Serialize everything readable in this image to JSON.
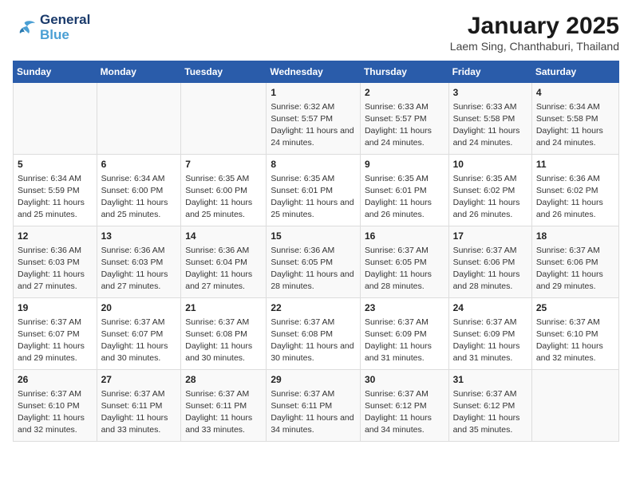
{
  "header": {
    "logo_line1": "General",
    "logo_line2": "Blue",
    "main_title": "January 2025",
    "sub_title": "Laem Sing, Chanthaburi, Thailand"
  },
  "weekdays": [
    "Sunday",
    "Monday",
    "Tuesday",
    "Wednesday",
    "Thursday",
    "Friday",
    "Saturday"
  ],
  "weeks": [
    [
      {
        "day": "",
        "text": ""
      },
      {
        "day": "",
        "text": ""
      },
      {
        "day": "",
        "text": ""
      },
      {
        "day": "1",
        "text": "Sunrise: 6:32 AM\nSunset: 5:57 PM\nDaylight: 11 hours and 24 minutes."
      },
      {
        "day": "2",
        "text": "Sunrise: 6:33 AM\nSunset: 5:57 PM\nDaylight: 11 hours and 24 minutes."
      },
      {
        "day": "3",
        "text": "Sunrise: 6:33 AM\nSunset: 5:58 PM\nDaylight: 11 hours and 24 minutes."
      },
      {
        "day": "4",
        "text": "Sunrise: 6:34 AM\nSunset: 5:58 PM\nDaylight: 11 hours and 24 minutes."
      }
    ],
    [
      {
        "day": "5",
        "text": "Sunrise: 6:34 AM\nSunset: 5:59 PM\nDaylight: 11 hours and 25 minutes."
      },
      {
        "day": "6",
        "text": "Sunrise: 6:34 AM\nSunset: 6:00 PM\nDaylight: 11 hours and 25 minutes."
      },
      {
        "day": "7",
        "text": "Sunrise: 6:35 AM\nSunset: 6:00 PM\nDaylight: 11 hours and 25 minutes."
      },
      {
        "day": "8",
        "text": "Sunrise: 6:35 AM\nSunset: 6:01 PM\nDaylight: 11 hours and 25 minutes."
      },
      {
        "day": "9",
        "text": "Sunrise: 6:35 AM\nSunset: 6:01 PM\nDaylight: 11 hours and 26 minutes."
      },
      {
        "day": "10",
        "text": "Sunrise: 6:35 AM\nSunset: 6:02 PM\nDaylight: 11 hours and 26 minutes."
      },
      {
        "day": "11",
        "text": "Sunrise: 6:36 AM\nSunset: 6:02 PM\nDaylight: 11 hours and 26 minutes."
      }
    ],
    [
      {
        "day": "12",
        "text": "Sunrise: 6:36 AM\nSunset: 6:03 PM\nDaylight: 11 hours and 27 minutes."
      },
      {
        "day": "13",
        "text": "Sunrise: 6:36 AM\nSunset: 6:03 PM\nDaylight: 11 hours and 27 minutes."
      },
      {
        "day": "14",
        "text": "Sunrise: 6:36 AM\nSunset: 6:04 PM\nDaylight: 11 hours and 27 minutes."
      },
      {
        "day": "15",
        "text": "Sunrise: 6:36 AM\nSunset: 6:05 PM\nDaylight: 11 hours and 28 minutes."
      },
      {
        "day": "16",
        "text": "Sunrise: 6:37 AM\nSunset: 6:05 PM\nDaylight: 11 hours and 28 minutes."
      },
      {
        "day": "17",
        "text": "Sunrise: 6:37 AM\nSunset: 6:06 PM\nDaylight: 11 hours and 28 minutes."
      },
      {
        "day": "18",
        "text": "Sunrise: 6:37 AM\nSunset: 6:06 PM\nDaylight: 11 hours and 29 minutes."
      }
    ],
    [
      {
        "day": "19",
        "text": "Sunrise: 6:37 AM\nSunset: 6:07 PM\nDaylight: 11 hours and 29 minutes."
      },
      {
        "day": "20",
        "text": "Sunrise: 6:37 AM\nSunset: 6:07 PM\nDaylight: 11 hours and 30 minutes."
      },
      {
        "day": "21",
        "text": "Sunrise: 6:37 AM\nSunset: 6:08 PM\nDaylight: 11 hours and 30 minutes."
      },
      {
        "day": "22",
        "text": "Sunrise: 6:37 AM\nSunset: 6:08 PM\nDaylight: 11 hours and 30 minutes."
      },
      {
        "day": "23",
        "text": "Sunrise: 6:37 AM\nSunset: 6:09 PM\nDaylight: 11 hours and 31 minutes."
      },
      {
        "day": "24",
        "text": "Sunrise: 6:37 AM\nSunset: 6:09 PM\nDaylight: 11 hours and 31 minutes."
      },
      {
        "day": "25",
        "text": "Sunrise: 6:37 AM\nSunset: 6:10 PM\nDaylight: 11 hours and 32 minutes."
      }
    ],
    [
      {
        "day": "26",
        "text": "Sunrise: 6:37 AM\nSunset: 6:10 PM\nDaylight: 11 hours and 32 minutes."
      },
      {
        "day": "27",
        "text": "Sunrise: 6:37 AM\nSunset: 6:11 PM\nDaylight: 11 hours and 33 minutes."
      },
      {
        "day": "28",
        "text": "Sunrise: 6:37 AM\nSunset: 6:11 PM\nDaylight: 11 hours and 33 minutes."
      },
      {
        "day": "29",
        "text": "Sunrise: 6:37 AM\nSunset: 6:11 PM\nDaylight: 11 hours and 34 minutes."
      },
      {
        "day": "30",
        "text": "Sunrise: 6:37 AM\nSunset: 6:12 PM\nDaylight: 11 hours and 34 minutes."
      },
      {
        "day": "31",
        "text": "Sunrise: 6:37 AM\nSunset: 6:12 PM\nDaylight: 11 hours and 35 minutes."
      },
      {
        "day": "",
        "text": ""
      }
    ]
  ]
}
